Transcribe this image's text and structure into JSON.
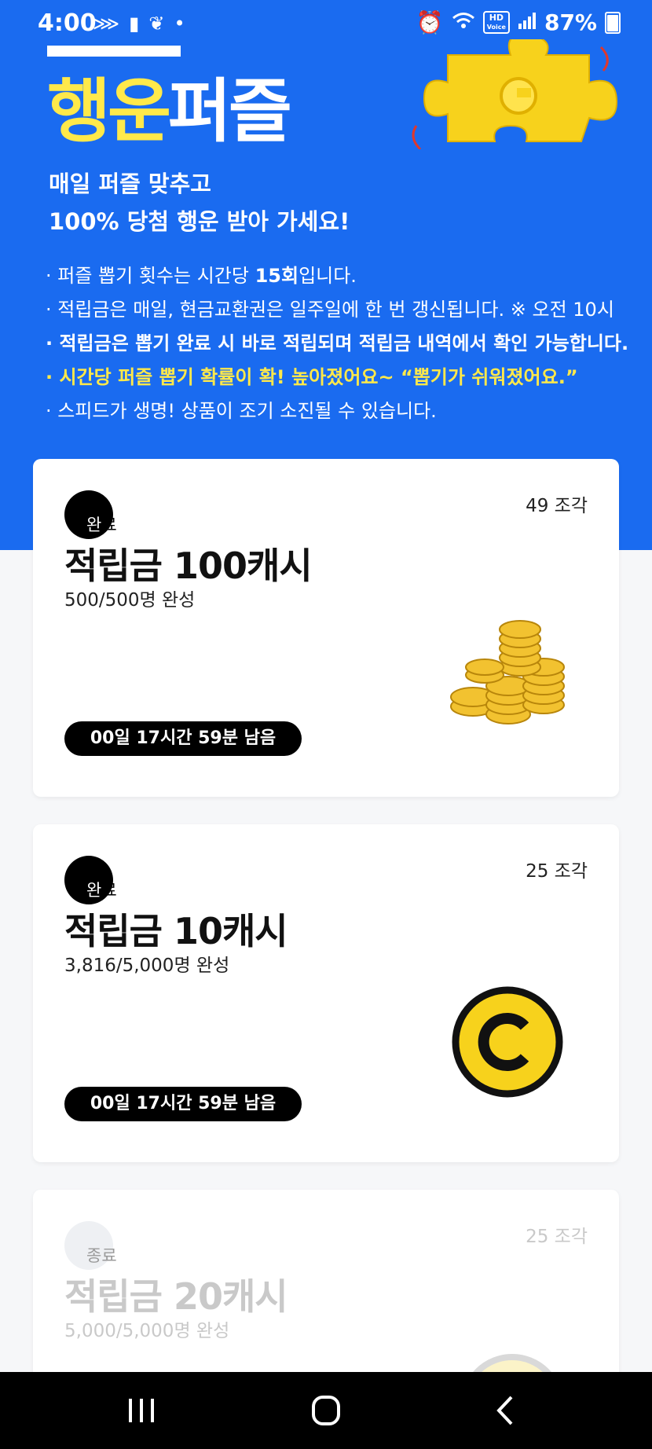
{
  "status_bar": {
    "time": "4:00",
    "hd_voice_top": "HD",
    "hd_voice_bottom": "Voice",
    "battery": "87%"
  },
  "hero": {
    "title_highlight": "행운",
    "title_rest": "퍼즐",
    "subtitle_line1": "매일 퍼즐 맞추고",
    "subtitle_line2": "100% 당첨 행운 받아 가세요!",
    "note1_pre": "· 퍼즐 뽑기 횟수는 시간당 ",
    "note1_bold": "15회",
    "note1_post": "입니다.",
    "note2": "· 적립금은 매일, 현금교환권은 일주일에 한 번 갱신됩니다. ※ 오전 10시",
    "note3": "· 적립금은 뽑기 완료 시 바로 적립되며 적립금 내역에서 확인 가능합니다.",
    "note4": "· 시간당 퍼즐 뽑기 확률이 확! 높아졌어요~ “뽑기가 쉬워졌어요.”",
    "note5": "· 스피드가 생명! 상품이 조기 소진될 수 있습니다."
  },
  "cards": [
    {
      "badge_a": "완",
      "badge_b": "료",
      "pieces": "49 조각",
      "prize": "적립금 100캐시",
      "progress": "500/500명 완성",
      "timer": "00일 17시간 59분 남음"
    },
    {
      "badge_a": "완",
      "badge_b": "료",
      "pieces": "25 조각",
      "prize": "적립금 10캐시",
      "progress": "3,816/5,000명 완성",
      "timer": "00일 17시간 59분 남음"
    },
    {
      "badge_a": "종",
      "badge_b": "료",
      "pieces": "25 조각",
      "prize": "적립금 20캐시",
      "progress": "5,000/5,000명 완성"
    }
  ],
  "colors": {
    "brand_blue": "#1a6bf0",
    "highlight_yellow": "#ffe94a",
    "coin_yellow": "#f7d21c"
  },
  "icons": [
    "puzzle-piece-icon",
    "coin-stack-icon",
    "cash-coin-icon",
    "recent-apps-icon",
    "home-icon",
    "back-icon"
  ]
}
